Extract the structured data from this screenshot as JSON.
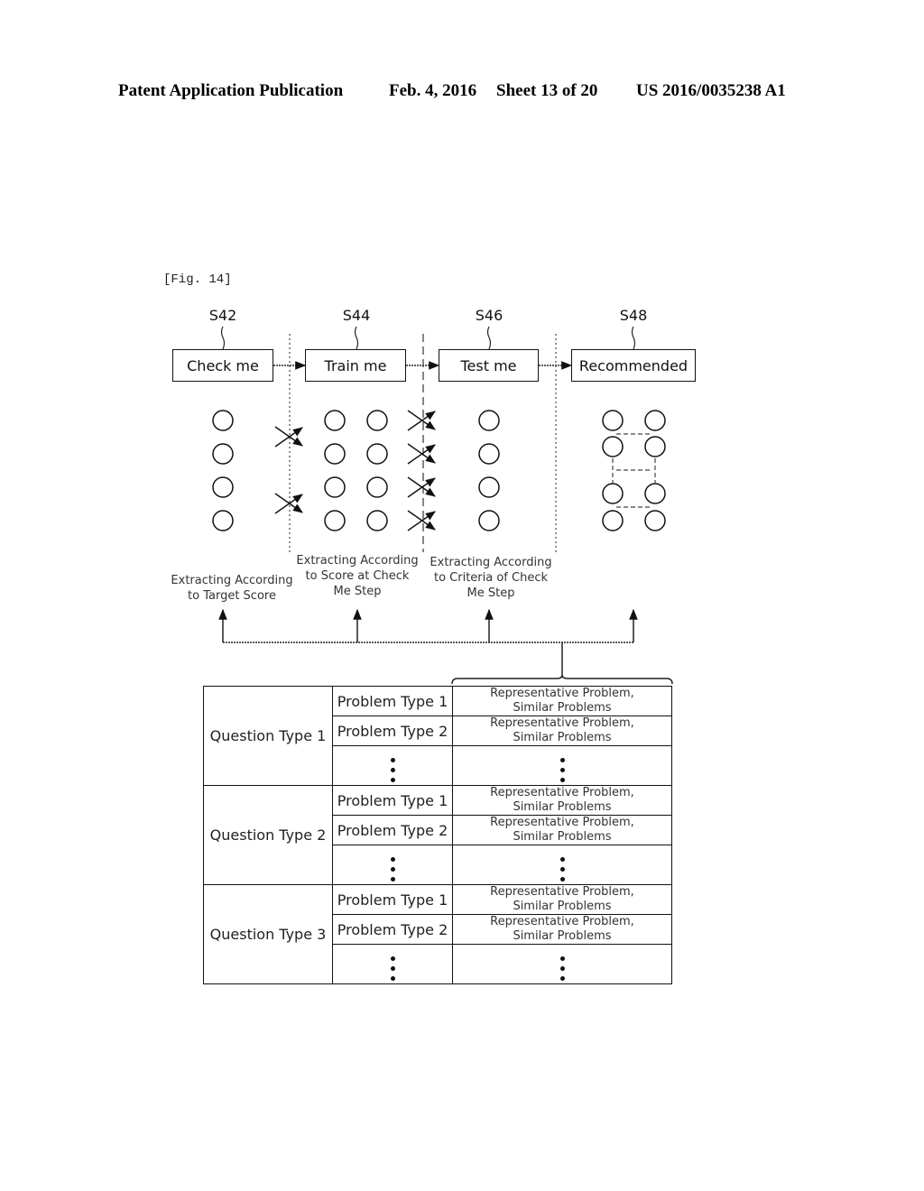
{
  "header": {
    "publication": "Patent Application Publication",
    "date": "Feb. 4, 2016",
    "sheet": "Sheet 13 of 20",
    "number": "US 2016/0035238 A1"
  },
  "figure": {
    "label": "[Fig. 14]",
    "steps": [
      {
        "id": "S42",
        "label": "Check me"
      },
      {
        "id": "S44",
        "label": "Train me"
      },
      {
        "id": "S46",
        "label": "Test me"
      },
      {
        "id": "S48",
        "label": "Recommended"
      }
    ],
    "captions": [
      "Extracting According\nto Target Score",
      "Extracting According\nto Score at Check\nMe Step",
      "Extracting According\nto Criteria of Check\nMe Step"
    ],
    "captions_lines": [
      [
        "Extracting According",
        "to Target Score"
      ],
      [
        "Extracting According",
        "to Score at Check",
        "Me Step"
      ],
      [
        "Extracting According",
        "to Criteria of Check",
        "Me Step"
      ]
    ],
    "circle_columns": [
      {
        "step": "S42",
        "count": 4
      },
      {
        "step": "S44",
        "count": 4
      },
      {
        "step": "S44",
        "count": 4
      },
      {
        "step": "S46",
        "count": 4
      },
      {
        "step": "S48",
        "count": 4
      },
      {
        "step": "S48",
        "count": 4
      }
    ],
    "crossings": {
      "between_S42_S44": 2,
      "between_S44_S46": 4
    }
  },
  "table": {
    "groups": [
      {
        "question": "Question Type 1",
        "rows": [
          {
            "problem": "Problem Type 1",
            "line1": "Representative Problem,",
            "line2": "Similar Problems"
          },
          {
            "problem": "Problem Type 2",
            "line1": "Representative Problem,",
            "line2": "Similar Problems"
          }
        ]
      },
      {
        "question": "Question Type 2",
        "rows": [
          {
            "problem": "Problem Type 1",
            "line1": "Representative Problem,",
            "line2": "Similar Problems"
          },
          {
            "problem": "Problem Type 2",
            "line1": "Representative Problem,",
            "line2": "Similar Problems"
          }
        ]
      },
      {
        "question": "Question Type 3",
        "rows": [
          {
            "problem": "Problem Type 1",
            "line1": "Representative Problem,",
            "line2": "Similar Problems"
          },
          {
            "problem": "Problem Type 2",
            "line1": "Representative Problem,",
            "line2": "Similar Problems"
          }
        ]
      }
    ]
  }
}
